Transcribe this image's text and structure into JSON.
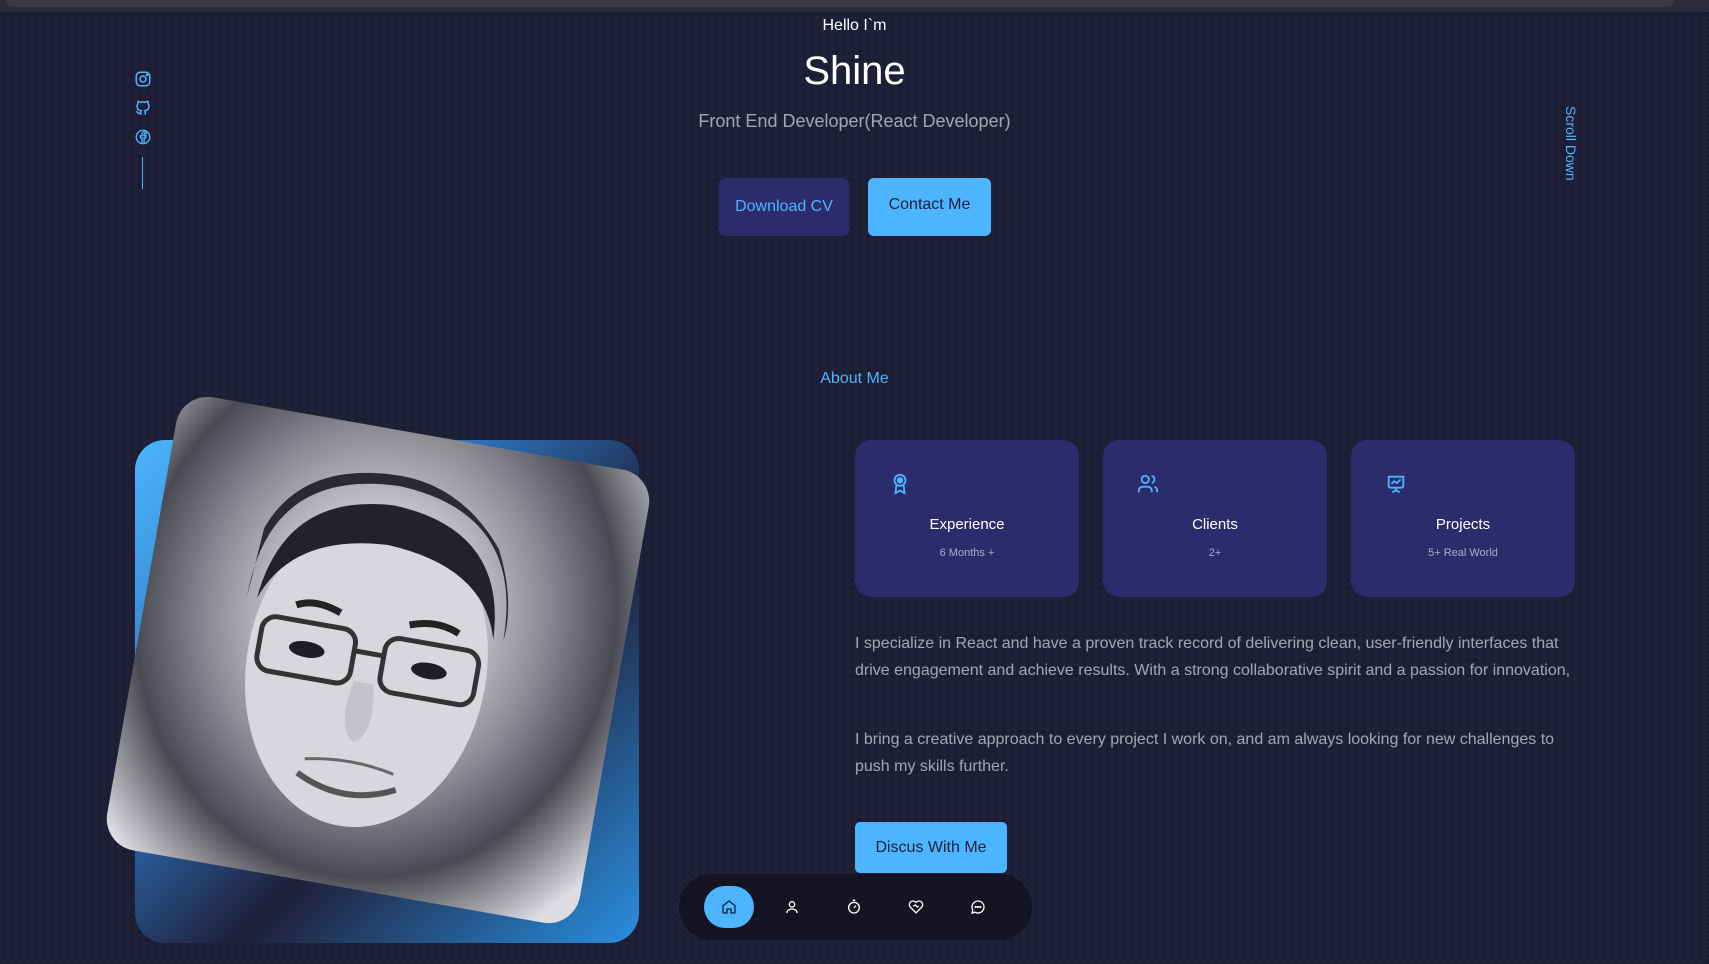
{
  "hero": {
    "greeting": "Hello I`m",
    "name": "Shine",
    "role": "Front End Developer(React Developer)",
    "download_cv": "Download CV",
    "contact_me": "Contact Me",
    "scroll_down": "Scroll Down"
  },
  "socials": [
    {
      "icon": "instagram-icon"
    },
    {
      "icon": "github-icon"
    },
    {
      "icon": "facebook-icon"
    }
  ],
  "about": {
    "label": "About Me",
    "cards": [
      {
        "icon": "award-icon",
        "title": "Experience",
        "subtitle": "6 Months +"
      },
      {
        "icon": "users-icon",
        "title": "Clients",
        "subtitle": "2+"
      },
      {
        "icon": "projects-icon",
        "title": "Projects",
        "subtitle": "5+ Real World"
      }
    ],
    "paragraph1": "I specialize in React and have a proven track record of delivering clean, user-friendly interfaces that drive engagement and achieve results. With a strong collaborative spirit and a passion for innovation,",
    "paragraph2": "I bring a creative approach to every project I work on, and am always looking for new challenges to push my skills further.",
    "discus_button": "Discus With Me"
  },
  "nav": {
    "items": [
      "home-icon",
      "user-icon",
      "timer-icon",
      "heart-handshake-icon",
      "message-icon"
    ],
    "active": "home-icon"
  },
  "colors": {
    "background": "#1f1f38",
    "primary": "#4db5ff",
    "variant": "#2c2c6c",
    "text_light": "rgba(255,255,255,0.6)"
  }
}
